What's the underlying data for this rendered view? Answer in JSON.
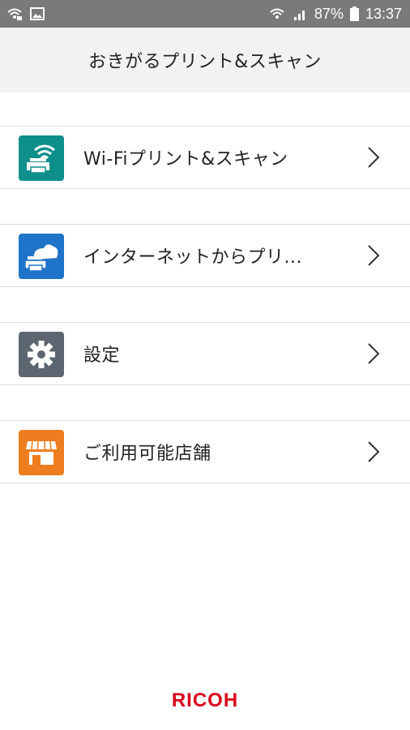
{
  "status_bar": {
    "battery": "87%",
    "time": "13:37",
    "icons_left": [
      "wifi-hotspot-icon",
      "gallery-icon"
    ],
    "icons_right": [
      "wifi-icon",
      "signal-icon",
      "battery-icon"
    ]
  },
  "header": {
    "title": "おきがるプリント&スキャン"
  },
  "menu": {
    "items": [
      {
        "label": "Wi-Fiプリント&スキャン",
        "icon": "wifi-print-icon",
        "color": "#0f8f8c"
      },
      {
        "label": "インターネットからプリ...",
        "icon": "cloud-print-icon",
        "color": "#1f73c9"
      },
      {
        "label": "設定",
        "icon": "gear-icon",
        "color": "#5d6670"
      },
      {
        "label": "ご利用可能店舗",
        "icon": "store-icon",
        "color": "#ee7d1f"
      }
    ]
  },
  "footer": {
    "brand": "RICOH",
    "brand_color": "#d9001b"
  }
}
